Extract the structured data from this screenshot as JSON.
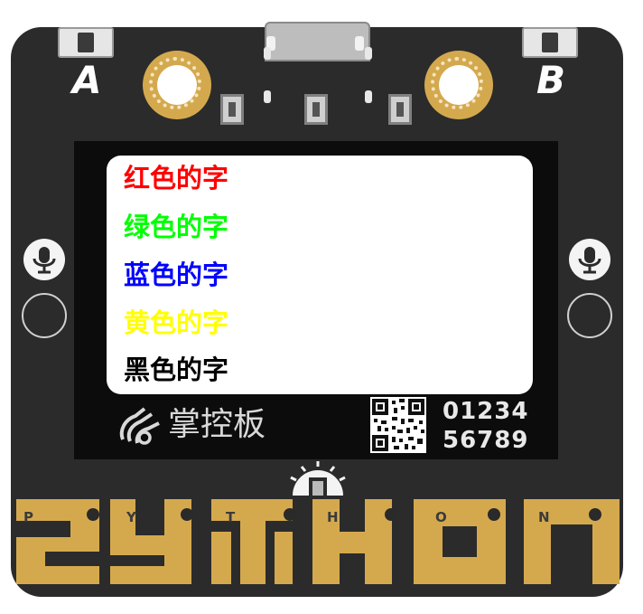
{
  "board": {
    "button_a": "A",
    "button_b": "B",
    "logo_text": "掌控板",
    "serial_line1": "01234",
    "serial_line2": "56789"
  },
  "screen": {
    "lines": [
      {
        "text": "红色的字",
        "color": "#ff0000"
      },
      {
        "text": "绿色的字",
        "color": "#00ff00"
      },
      {
        "text": "蓝色的字",
        "color": "#0000ff"
      },
      {
        "text": "黄色的字",
        "color": "#ffff00"
      },
      {
        "text": "黑色的字",
        "color": "#000000"
      }
    ]
  },
  "pins": [
    "P",
    "Y",
    "T",
    "H",
    "O",
    "N"
  ],
  "colors": {
    "board": "#2b2b2b",
    "gold": "#d4a94e"
  }
}
